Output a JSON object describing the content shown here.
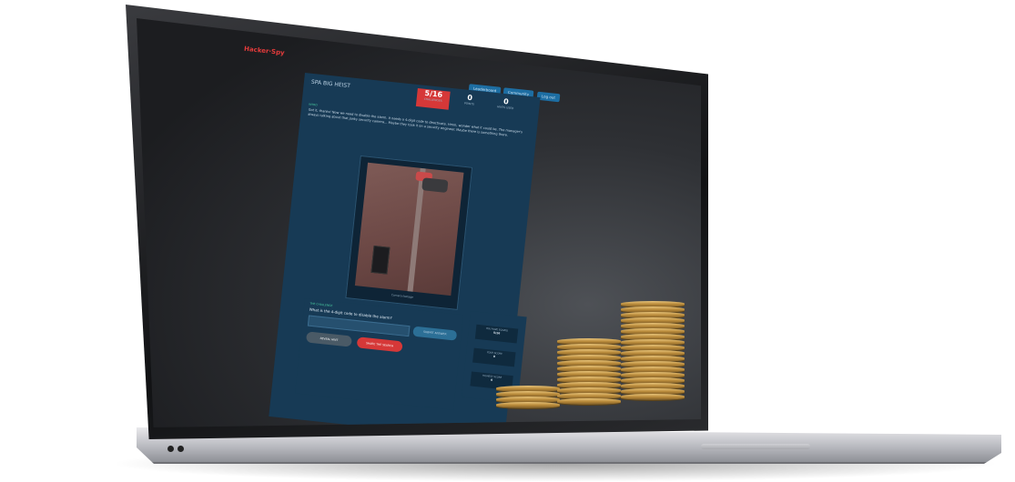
{
  "app": {
    "logo_text": "Hacker·Spy",
    "nav": [
      "Leaderboard",
      "Community",
      "Log out"
    ]
  },
  "panel": {
    "title": "SPA BIG HEIST",
    "stats": [
      {
        "value": "5/16",
        "label": "CHALLENGES"
      },
      {
        "value": "0",
        "label": "POINTS"
      },
      {
        "value": "0",
        "label": "HINTS USED"
      }
    ],
    "intro_label": "INTRO",
    "intro_text": "Got it, thanks! Now we need to disable the alarm. It needs a 4-digit code to deactivate. Hmm, wonder what it could be. The manager's always talking about that janky security camera... Maybe they took it on a security engineer. Maybe there is something there.",
    "photo_caption": "Camera footage"
  },
  "challenge": {
    "label": "THE CHALLENGE",
    "question": "What is the 4-digit code to disable the alarm?",
    "input_placeholder": "",
    "submit_label": "SUBMIT ANSWER",
    "hint_label": "REVEAL HINT",
    "share_label": "SHARE THE SEARCH"
  },
  "sidebar": {
    "items": [
      {
        "label": "YOU HAVE SOLVED",
        "value": "5/16"
      },
      {
        "label": "YOUR SCORE",
        "value": "0"
      },
      {
        "label": "HIGHEST SCORE",
        "value": "0"
      }
    ]
  },
  "colors": {
    "panel_bg": "#173a55",
    "accent_red": "#d63838",
    "accent_green": "#4cd2a4",
    "nav_blue": "#1d6ea3"
  }
}
